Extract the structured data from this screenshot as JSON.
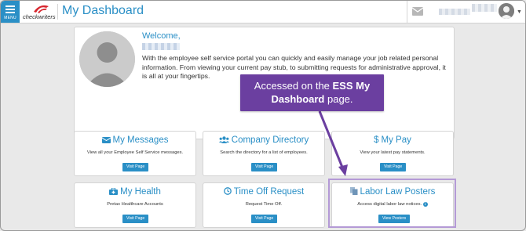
{
  "header": {
    "menu_label": "MENU",
    "logo_text": "checkwriters",
    "page_title": "My Dashboard",
    "icons": [
      "hamburger-icon",
      "mail-icon",
      "chevron-down-icon"
    ]
  },
  "welcome": {
    "title": "Welcome,",
    "body": "With the employee self service portal you can quickly and easily manage your job related personal information. From viewing your current pay stub, to submitting requests for administrative approval, it is all at your fingertips."
  },
  "cards": [
    {
      "title": "My Messages",
      "icon": "envelope-icon",
      "desc": "View all your Employee Self Service messages.",
      "button": "Visit Page"
    },
    {
      "title": "Company Directory",
      "icon": "users-icon",
      "desc": "Search the directory for a list of employees.",
      "button": "Visit Page"
    },
    {
      "title": "My Pay",
      "icon": "dollar-icon",
      "desc": "View your latest pay statements.",
      "button": "Visit Page"
    },
    {
      "title": "My Health",
      "icon": "medkit-icon",
      "desc": "Pretax Healthcare Accounts",
      "button": "Visit Page"
    },
    {
      "title": "Time Off Request",
      "icon": "clock-icon",
      "desc": "Request Time Off.",
      "button": "Visit Page"
    },
    {
      "title": "Labor Law Posters",
      "icon": "copy-icon",
      "desc": "Access digital labor law notices.",
      "button": "View Posters"
    }
  ],
  "callout": {
    "line1_prefix": "Accessed on the ",
    "line1_bold": "ESS My",
    "line2_bold": "Dashboard",
    "line2_suffix": " page."
  },
  "colors": {
    "accent": "#2a8fc6",
    "callout": "#6b3fa0",
    "highlight_border": "#b49ad6",
    "logo_red": "#d7262e"
  }
}
